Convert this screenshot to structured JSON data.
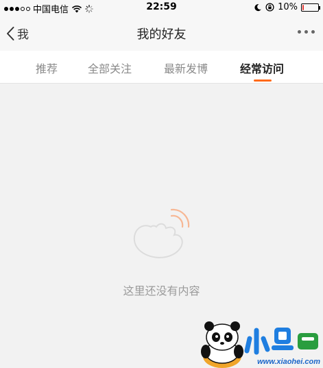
{
  "status_bar": {
    "carrier": "中国电信",
    "time": "22:59",
    "battery": "10%",
    "battery_level": 0.1,
    "signal_bars_filled": 3,
    "signal_bars_total": 5,
    "battery_color": "#e53935"
  },
  "nav": {
    "back_label": "我",
    "title": "我的好友",
    "back_icon": "chevron-left-icon",
    "more_icon": "more-dots-icon"
  },
  "tabs": [
    {
      "label": "推荐",
      "active": false
    },
    {
      "label": "全部关注",
      "active": false
    },
    {
      "label": "最新发博",
      "active": false
    },
    {
      "label": "经常访问",
      "active": true
    }
  ],
  "accent_color": "#ff6a1a",
  "empty_state": {
    "icon": "weibo-outline-icon",
    "text": "这里还没有内容"
  },
  "watermark": {
    "url": "www.xiaohei.com",
    "logo_text": "小黑游戏"
  }
}
